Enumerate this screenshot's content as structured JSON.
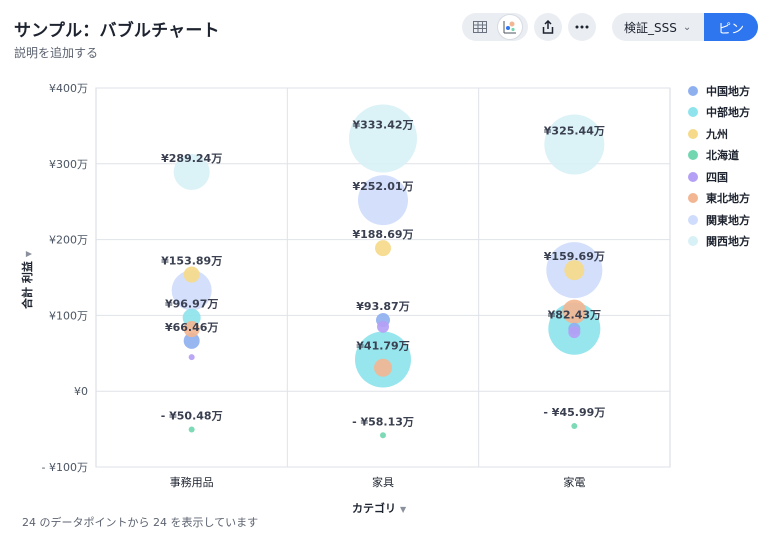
{
  "header": {
    "title": "サンプル：バブルチャート",
    "subtitle": "説明を追加する",
    "dataset": "検証_SSS",
    "pin_label": "ピン"
  },
  "footer": {
    "status": "24 のデータポイントから 24 を表示しています"
  },
  "icons": [
    "table-icon",
    "chart-type-icon",
    "share-icon",
    "more-icon",
    "chevron-down-icon"
  ],
  "chart_data": {
    "type": "scatter",
    "xlabel": "カテゴリ",
    "ylabel": "合計 利益",
    "categories": [
      "事務用品",
      "家具",
      "家電"
    ],
    "y_ticks": [
      "¥400万",
      "¥300万",
      "¥200万",
      "¥100万",
      "¥0",
      "- ¥100万"
    ],
    "ylim": [
      -100,
      400
    ],
    "grid": true,
    "legend_position": "right",
    "series": [
      {
        "name": "中国地方",
        "color": "#8fb0ef",
        "values": [
          66.46,
          93.87,
          82.43
        ],
        "size": [
          8,
          7,
          6
        ]
      },
      {
        "name": "中部地方",
        "color": "#8ee3ec",
        "values": [
          96.97,
          41.79,
          82.43
        ],
        "size": [
          9,
          28,
          26
        ]
      },
      {
        "name": "九州",
        "color": "#f6da8a",
        "values": [
          153.89,
          188.69,
          159.69
        ],
        "size": [
          8,
          8,
          10
        ]
      },
      {
        "name": "北海道",
        "color": "#72d7b0",
        "values": [
          -50.48,
          -58.13,
          -45.99
        ],
        "size": [
          3,
          3,
          3
        ]
      },
      {
        "name": "四国",
        "color": "#b4a0f5",
        "values": [
          45.0,
          85.0,
          78.0
        ],
        "size": [
          3,
          6,
          6
        ]
      },
      {
        "name": "東北地方",
        "color": "#f2b693",
        "values": [
          82.0,
          31.0,
          105.0
        ],
        "size": [
          8,
          9,
          12
        ]
      },
      {
        "name": "関東地方",
        "color": "#cfdcfb",
        "values": [
          133.0,
          252.01,
          159.69
        ],
        "size": [
          20,
          25,
          28
        ]
      },
      {
        "name": "関西地方",
        "color": "#d8f1f6",
        "values": [
          289.24,
          333.42,
          325.44
        ],
        "size": [
          18,
          34,
          30
        ]
      }
    ],
    "labels": [
      {
        "category": "事務用品",
        "value": 289.24,
        "text": "¥289.24万"
      },
      {
        "category": "事務用品",
        "value": 153.89,
        "text": "¥153.89万"
      },
      {
        "category": "事務用品",
        "value": 96.97,
        "text": "¥96.97万"
      },
      {
        "category": "事務用品",
        "value": 66.46,
        "text": "¥66.46万"
      },
      {
        "category": "事務用品",
        "value": -50.48,
        "text": "- ¥50.48万"
      },
      {
        "category": "家具",
        "value": 333.42,
        "text": "¥333.42万"
      },
      {
        "category": "家具",
        "value": 252.01,
        "text": "¥252.01万"
      },
      {
        "category": "家具",
        "value": 188.69,
        "text": "¥188.69万"
      },
      {
        "category": "家具",
        "value": 93.87,
        "text": "¥93.87万"
      },
      {
        "category": "家具",
        "value": 41.79,
        "text": "¥41.79万"
      },
      {
        "category": "家具",
        "value": -58.13,
        "text": "- ¥58.13万"
      },
      {
        "category": "家電",
        "value": 325.44,
        "text": "¥325.44万"
      },
      {
        "category": "家電",
        "value": 159.69,
        "text": "¥159.69万"
      },
      {
        "category": "家電",
        "value": 82.43,
        "text": "¥82.43万"
      },
      {
        "category": "家電",
        "value": -45.99,
        "text": "- ¥45.99万"
      }
    ]
  }
}
